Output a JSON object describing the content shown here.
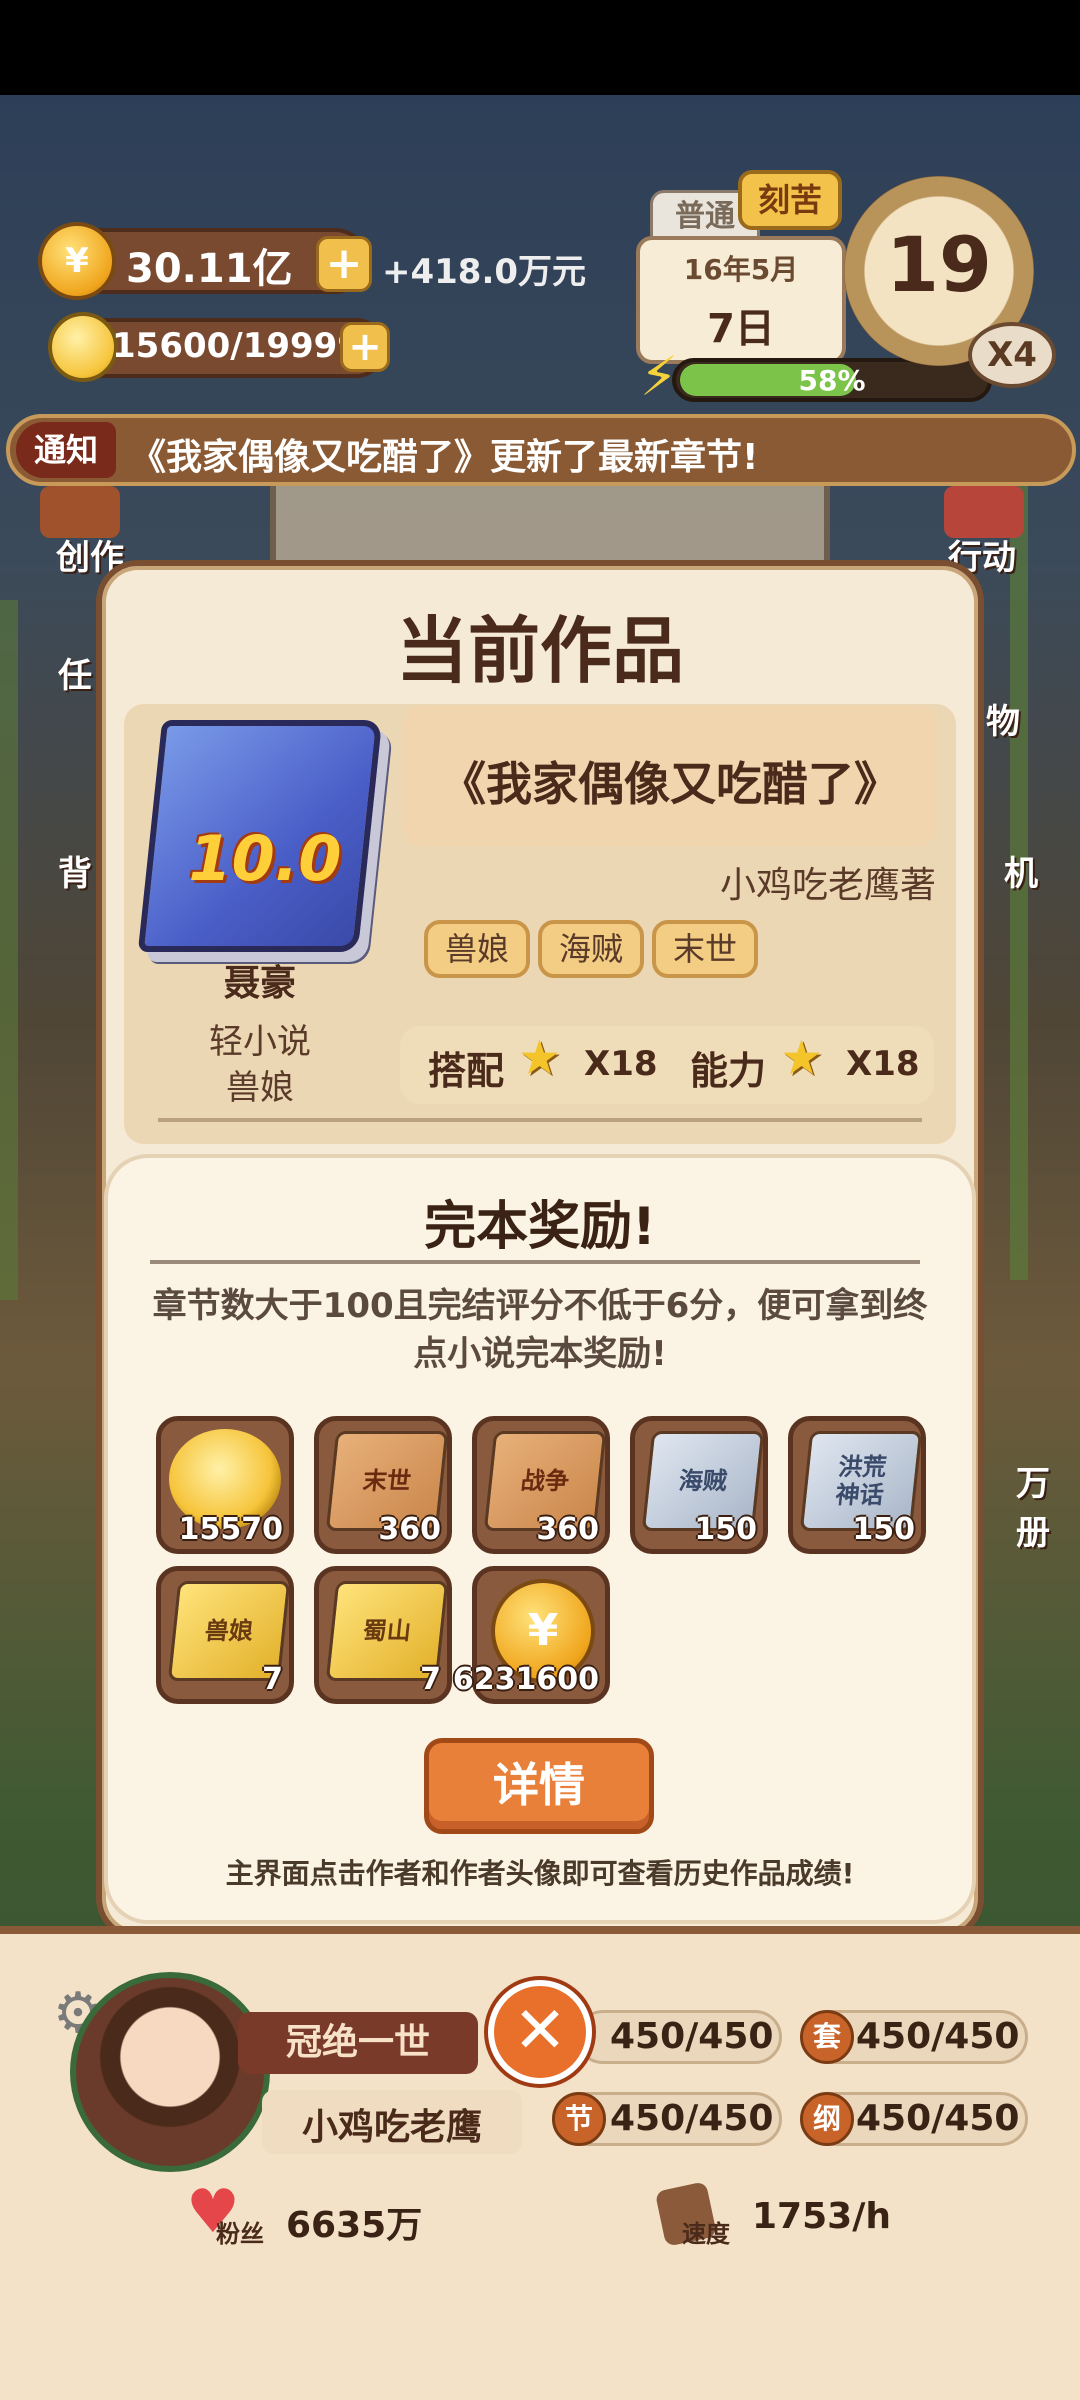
{
  "hud": {
    "money": "30.11亿",
    "money_plus": "+",
    "income": "+418.0万元",
    "energy": "15600/19999",
    "energy_plus": "+",
    "mode_normal": "普通",
    "mode_hard": "刻苦",
    "date_month": "16年5月",
    "date_day": "7日",
    "progress_percent": 58,
    "progress_text": "58%",
    "day_counter": "19",
    "speed_multiplier": "X4"
  },
  "notice": {
    "tag": "通知",
    "text": "《我家偶像又吃醋了》更新了最新章节!"
  },
  "side_menu": {
    "create": "创作",
    "task": "任",
    "bag": "背",
    "action": "行动",
    "item": "物",
    "phone": "机",
    "book": "万册"
  },
  "work_modal": {
    "title": "当前作品",
    "score": "10.0",
    "grade": "聂豪",
    "genre": "轻小说",
    "subgenre": "兽娘",
    "book_title": "《我家偶像又吃醋了》",
    "author": "小鸡吃老鹰著",
    "tags": [
      "兽娘",
      "海贼",
      "末世"
    ],
    "match_label": "搭配",
    "match_value": "X18",
    "ability_label": "能力",
    "ability_value": "X18"
  },
  "reward_modal": {
    "title": "完本奖励!",
    "description": "章节数大于100且完结评分不低于6分，便可拿到终点小说完本奖励!",
    "items": [
      {
        "icon": "energy-bulb-icon",
        "label": "",
        "count": "15570",
        "style": "bulb"
      },
      {
        "icon": "book-icon",
        "label": "末世",
        "count": "360",
        "style": "orange"
      },
      {
        "icon": "book-icon",
        "label": "战争",
        "count": "360",
        "style": "orange"
      },
      {
        "icon": "book-icon",
        "label": "海贼",
        "count": "150",
        "style": "silver"
      },
      {
        "icon": "book-icon",
        "label": "洪荒神话",
        "count": "150",
        "style": "silver"
      },
      {
        "icon": "book-icon",
        "label": "兽娘",
        "count": "7",
        "style": "gold"
      },
      {
        "icon": "book-icon",
        "label": "蜀山",
        "count": "7",
        "style": "gold"
      },
      {
        "icon": "coin-icon",
        "label": "",
        "count": "6231600",
        "style": "coin"
      }
    ],
    "detail_button": "详情",
    "hint": "主界面点击作者和作者头像即可查看历史作品成绩!"
  },
  "author_panel": {
    "rank": "冠绝一世",
    "name": "小鸡吃老鹰",
    "close": "✕",
    "stats": [
      {
        "badge": "",
        "value": "450/450"
      },
      {
        "badge": "套",
        "value": "450/450"
      },
      {
        "badge": "节",
        "value": "450/450"
      },
      {
        "badge": "纲",
        "value": "450/450"
      }
    ],
    "fans_label": "粉丝",
    "fans_value": "6635万",
    "speed_label": "速度",
    "speed_value": "1753/h"
  },
  "colors": {
    "accent_orange": "#e8803a",
    "panel_cream": "#f5ead6",
    "border_brown": "#7a4e30",
    "progress_green": "#7cc34a"
  }
}
